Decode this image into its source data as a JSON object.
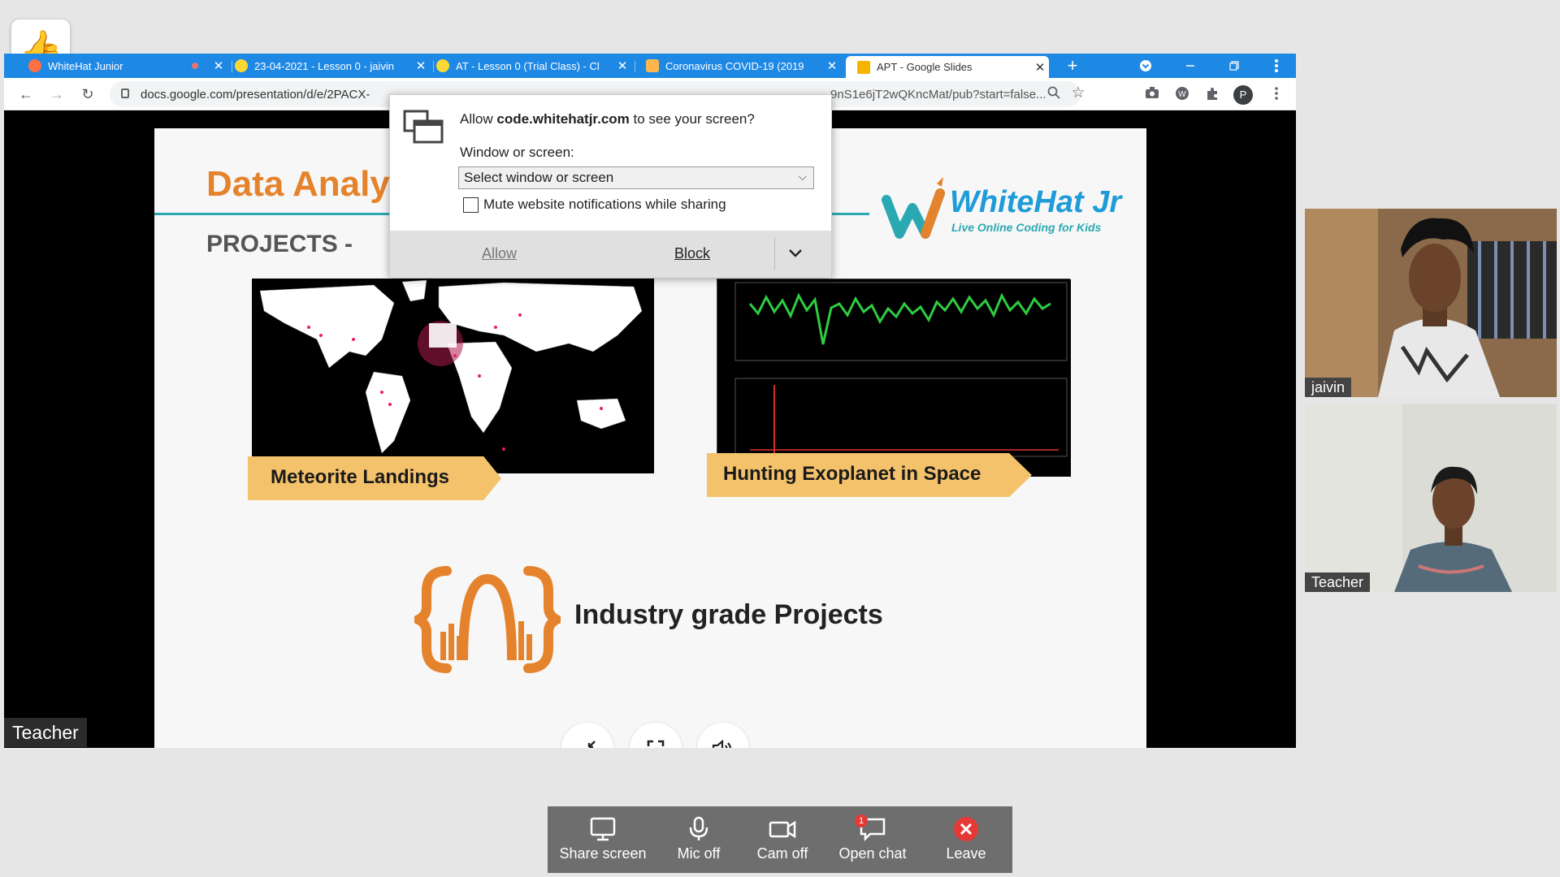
{
  "thumbs": {
    "emoji": "👍"
  },
  "browser": {
    "tabs": [
      {
        "title": "WhiteHat Junior",
        "active": false
      },
      {
        "title": "23-04-2021 - Lesson 0 - jaivin",
        "active": false
      },
      {
        "title": "AT - Lesson 0 (Trial Class) - Cl",
        "active": false
      },
      {
        "title": "Coronavirus COVID-19 (2019",
        "active": false
      },
      {
        "title": "APT - Google Slides",
        "active": true
      }
    ],
    "new_tab": "+",
    "url_left": "docs.google.com/presentation/d/e/2PACX-",
    "url_right": "9nS1e6jT2wQKncMat/pub?start=false...",
    "profile_initial": "P"
  },
  "permission_dialog": {
    "msg_prefix": "Allow ",
    "domain": "code.whitehatjr.com",
    "msg_suffix": " to see your screen?",
    "window_label": "Window or screen:",
    "select_value": "Select window or screen",
    "mute_label": "Mute website notifications while sharing",
    "allow": "Allow",
    "block": "Block"
  },
  "slide": {
    "title": "Data Analys",
    "subtitle": "PROJECTS -",
    "brand_name": "WhiteHat Jr",
    "brand_tagline": "Live Online Coding for Kids",
    "project1": "Meteorite Landings",
    "project2": "Hunting Exoplanet in Space",
    "industry_text": "Industry grade Projects"
  },
  "share_label": "Teacher",
  "participants": [
    {
      "name": "jaivin"
    },
    {
      "name": "Teacher"
    }
  ],
  "controls": {
    "share_screen": "Share screen",
    "mic_off": "Mic off",
    "cam_off": "Cam off",
    "open_chat": "Open chat",
    "chat_badge": "1",
    "leave": "Leave"
  },
  "colors": {
    "tab_strip": "#1e88e5",
    "slide_orange": "#e5832d",
    "slide_teal": "#2aa9b3",
    "leave_red": "#e53935"
  }
}
